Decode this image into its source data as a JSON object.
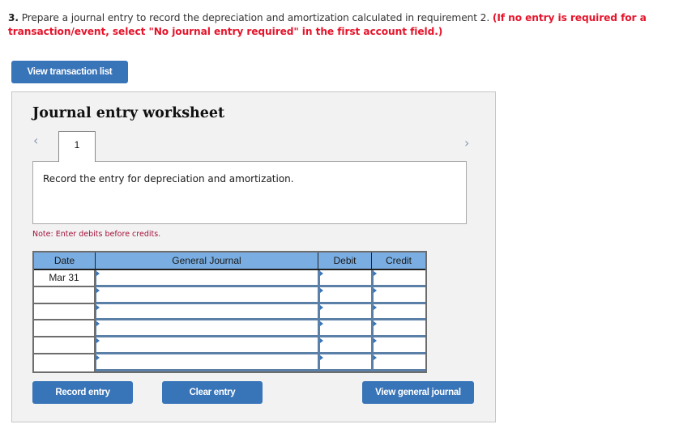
{
  "question": {
    "number": "3.",
    "text": "Prepare a journal entry to record the depreciation and amortization calculated in requirement 2.",
    "instruction": "(If no entry is required for a transaction/event, select \"No journal entry required\" in the first account field.)"
  },
  "buttons": {
    "view_transaction_list": "View transaction list",
    "record_entry": "Record entry",
    "clear_entry": "Clear entry",
    "view_general_journal": "View general journal"
  },
  "worksheet": {
    "title": "Journal entry worksheet",
    "prev_icon": "‹",
    "next_icon": "›",
    "tabs": [
      {
        "label": "1",
        "active": true
      }
    ],
    "description": "Record the entry for depreciation and amortization.",
    "note": "Note: Enter debits before credits."
  },
  "journal": {
    "columns": {
      "date": "Date",
      "account": "General Journal",
      "debit": "Debit",
      "credit": "Credit"
    },
    "rows": [
      {
        "date": "Mar 31",
        "account": "",
        "debit": "",
        "credit": ""
      },
      {
        "date": "",
        "account": "",
        "debit": "",
        "credit": ""
      },
      {
        "date": "",
        "account": "",
        "debit": "",
        "credit": ""
      },
      {
        "date": "",
        "account": "",
        "debit": "",
        "credit": ""
      },
      {
        "date": "",
        "account": "",
        "debit": "",
        "credit": ""
      },
      {
        "date": "",
        "account": "",
        "debit": "",
        "credit": ""
      }
    ]
  },
  "colors": {
    "button": "#3874b8",
    "header": "#7aaee2",
    "instruction_red": "#e5142b",
    "note": "#a3123b"
  }
}
